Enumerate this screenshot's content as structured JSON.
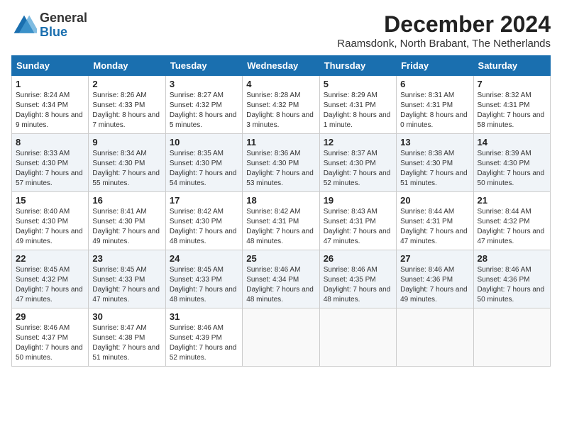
{
  "logo": {
    "general": "General",
    "blue": "Blue"
  },
  "title": "December 2024",
  "subtitle": "Raamsdonk, North Brabant, The Netherlands",
  "header_days": [
    "Sunday",
    "Monday",
    "Tuesday",
    "Wednesday",
    "Thursday",
    "Friday",
    "Saturday"
  ],
  "weeks": [
    [
      {
        "day": "1",
        "sunrise": "Sunrise: 8:24 AM",
        "sunset": "Sunset: 4:34 PM",
        "daylight": "Daylight: 8 hours and 9 minutes."
      },
      {
        "day": "2",
        "sunrise": "Sunrise: 8:26 AM",
        "sunset": "Sunset: 4:33 PM",
        "daylight": "Daylight: 8 hours and 7 minutes."
      },
      {
        "day": "3",
        "sunrise": "Sunrise: 8:27 AM",
        "sunset": "Sunset: 4:32 PM",
        "daylight": "Daylight: 8 hours and 5 minutes."
      },
      {
        "day": "4",
        "sunrise": "Sunrise: 8:28 AM",
        "sunset": "Sunset: 4:32 PM",
        "daylight": "Daylight: 8 hours and 3 minutes."
      },
      {
        "day": "5",
        "sunrise": "Sunrise: 8:29 AM",
        "sunset": "Sunset: 4:31 PM",
        "daylight": "Daylight: 8 hours and 1 minute."
      },
      {
        "day": "6",
        "sunrise": "Sunrise: 8:31 AM",
        "sunset": "Sunset: 4:31 PM",
        "daylight": "Daylight: 8 hours and 0 minutes."
      },
      {
        "day": "7",
        "sunrise": "Sunrise: 8:32 AM",
        "sunset": "Sunset: 4:31 PM",
        "daylight": "Daylight: 7 hours and 58 minutes."
      }
    ],
    [
      {
        "day": "8",
        "sunrise": "Sunrise: 8:33 AM",
        "sunset": "Sunset: 4:30 PM",
        "daylight": "Daylight: 7 hours and 57 minutes."
      },
      {
        "day": "9",
        "sunrise": "Sunrise: 8:34 AM",
        "sunset": "Sunset: 4:30 PM",
        "daylight": "Daylight: 7 hours and 55 minutes."
      },
      {
        "day": "10",
        "sunrise": "Sunrise: 8:35 AM",
        "sunset": "Sunset: 4:30 PM",
        "daylight": "Daylight: 7 hours and 54 minutes."
      },
      {
        "day": "11",
        "sunrise": "Sunrise: 8:36 AM",
        "sunset": "Sunset: 4:30 PM",
        "daylight": "Daylight: 7 hours and 53 minutes."
      },
      {
        "day": "12",
        "sunrise": "Sunrise: 8:37 AM",
        "sunset": "Sunset: 4:30 PM",
        "daylight": "Daylight: 7 hours and 52 minutes."
      },
      {
        "day": "13",
        "sunrise": "Sunrise: 8:38 AM",
        "sunset": "Sunset: 4:30 PM",
        "daylight": "Daylight: 7 hours and 51 minutes."
      },
      {
        "day": "14",
        "sunrise": "Sunrise: 8:39 AM",
        "sunset": "Sunset: 4:30 PM",
        "daylight": "Daylight: 7 hours and 50 minutes."
      }
    ],
    [
      {
        "day": "15",
        "sunrise": "Sunrise: 8:40 AM",
        "sunset": "Sunset: 4:30 PM",
        "daylight": "Daylight: 7 hours and 49 minutes."
      },
      {
        "day": "16",
        "sunrise": "Sunrise: 8:41 AM",
        "sunset": "Sunset: 4:30 PM",
        "daylight": "Daylight: 7 hours and 49 minutes."
      },
      {
        "day": "17",
        "sunrise": "Sunrise: 8:42 AM",
        "sunset": "Sunset: 4:30 PM",
        "daylight": "Daylight: 7 hours and 48 minutes."
      },
      {
        "day": "18",
        "sunrise": "Sunrise: 8:42 AM",
        "sunset": "Sunset: 4:31 PM",
        "daylight": "Daylight: 7 hours and 48 minutes."
      },
      {
        "day": "19",
        "sunrise": "Sunrise: 8:43 AM",
        "sunset": "Sunset: 4:31 PM",
        "daylight": "Daylight: 7 hours and 47 minutes."
      },
      {
        "day": "20",
        "sunrise": "Sunrise: 8:44 AM",
        "sunset": "Sunset: 4:31 PM",
        "daylight": "Daylight: 7 hours and 47 minutes."
      },
      {
        "day": "21",
        "sunrise": "Sunrise: 8:44 AM",
        "sunset": "Sunset: 4:32 PM",
        "daylight": "Daylight: 7 hours and 47 minutes."
      }
    ],
    [
      {
        "day": "22",
        "sunrise": "Sunrise: 8:45 AM",
        "sunset": "Sunset: 4:32 PM",
        "daylight": "Daylight: 7 hours and 47 minutes."
      },
      {
        "day": "23",
        "sunrise": "Sunrise: 8:45 AM",
        "sunset": "Sunset: 4:33 PM",
        "daylight": "Daylight: 7 hours and 47 minutes."
      },
      {
        "day": "24",
        "sunrise": "Sunrise: 8:45 AM",
        "sunset": "Sunset: 4:33 PM",
        "daylight": "Daylight: 7 hours and 48 minutes."
      },
      {
        "day": "25",
        "sunrise": "Sunrise: 8:46 AM",
        "sunset": "Sunset: 4:34 PM",
        "daylight": "Daylight: 7 hours and 48 minutes."
      },
      {
        "day": "26",
        "sunrise": "Sunrise: 8:46 AM",
        "sunset": "Sunset: 4:35 PM",
        "daylight": "Daylight: 7 hours and 48 minutes."
      },
      {
        "day": "27",
        "sunrise": "Sunrise: 8:46 AM",
        "sunset": "Sunset: 4:36 PM",
        "daylight": "Daylight: 7 hours and 49 minutes."
      },
      {
        "day": "28",
        "sunrise": "Sunrise: 8:46 AM",
        "sunset": "Sunset: 4:36 PM",
        "daylight": "Daylight: 7 hours and 50 minutes."
      }
    ],
    [
      {
        "day": "29",
        "sunrise": "Sunrise: 8:46 AM",
        "sunset": "Sunset: 4:37 PM",
        "daylight": "Daylight: 7 hours and 50 minutes."
      },
      {
        "day": "30",
        "sunrise": "Sunrise: 8:47 AM",
        "sunset": "Sunset: 4:38 PM",
        "daylight": "Daylight: 7 hours and 51 minutes."
      },
      {
        "day": "31",
        "sunrise": "Sunrise: 8:46 AM",
        "sunset": "Sunset: 4:39 PM",
        "daylight": "Daylight: 7 hours and 52 minutes."
      },
      null,
      null,
      null,
      null
    ]
  ]
}
